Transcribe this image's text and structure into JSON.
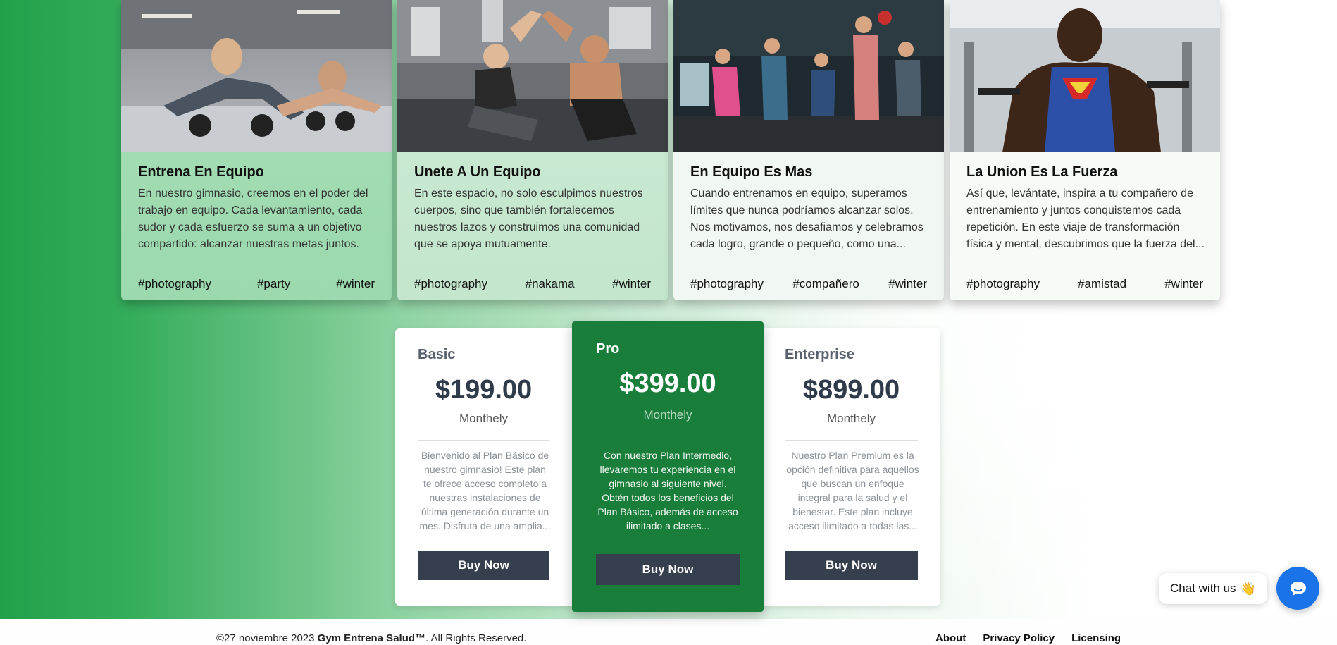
{
  "cards": [
    {
      "title": "Entrena En Equipo",
      "text": "En nuestro gimnasio, creemos en el poder del trabajo en equipo. Cada levantamiento, cada sudor y cada esfuerzo se suma a un objetivo compartido: alcanzar nuestras metas juntos.",
      "tags": [
        "#photography",
        "#party",
        "#winter"
      ]
    },
    {
      "title": "Unete A Un Equipo",
      "text": "En este espacio, no solo esculpimos nuestros cuerpos, sino que también fortalecemos nuestros lazos y construimos una comunidad que se apoya mutuamente.",
      "tags": [
        "#photography",
        "#nakama",
        "#winter"
      ]
    },
    {
      "title": "En Equipo Es Mas",
      "text": "Cuando entrenamos en equipo, superamos límites que nunca podríamos alcanzar solos. Nos motivamos, nos desafiamos y celebramos cada logro, grande o pequeño, como una...",
      "tags": [
        "#photography",
        "#compañero",
        "#winter"
      ]
    },
    {
      "title": "La Union Es La Fuerza",
      "text": "Así que, levántate, inspira a tu compañero de entrenamiento y juntos conquistemos cada repetición. En este viaje de transformación física y mental, descubrimos que la fuerza del...",
      "tags": [
        "#photography",
        "#amistad",
        "#winter"
      ]
    }
  ],
  "plans": {
    "basic": {
      "name": "Basic",
      "price": "$199.00",
      "period": "Monthely",
      "description": "Bienvenido al Plan Básico de nuestro gimnasio! Este plan te ofrece acceso completo a nuestras instalaciones de última generación durante un mes. Disfruta de una amplia...",
      "button": "Buy Now"
    },
    "pro": {
      "name": "Pro",
      "price": "$399.00",
      "period": "Monthely",
      "description": "Con nuestro Plan Intermedio, llevaremos tu experiencia en el gimnasio al siguiente nivel. Obtén todos los beneficios del Plan Básico, además de acceso ilimitado a clases...",
      "button": "Buy Now"
    },
    "enterprise": {
      "name": "Enterprise",
      "price": "$899.00",
      "period": "Monthely",
      "description": "Nuestro Plan Premium es la opción definitiva para aquellos que buscan un enfoque integral para la salud y el bienestar. Este plan incluye acceso ilimitado a todas las...",
      "button": "Buy Now"
    }
  },
  "chat": {
    "label": "Chat with us",
    "wave": "👋",
    "icon": "chat-bubble-icon",
    "color": "#1a73e8"
  },
  "footer": {
    "date": "©27 noviembre 2023",
    "brand": "Gym Entrena Salud™",
    "rights": ". All Rights Reserved.",
    "links": [
      "About",
      "Privacy Policy",
      "Licensing"
    ]
  },
  "colors": {
    "accent_green": "#1a7e3b",
    "button_dark": "#363f4d",
    "price_text": "#2f3a4a"
  }
}
